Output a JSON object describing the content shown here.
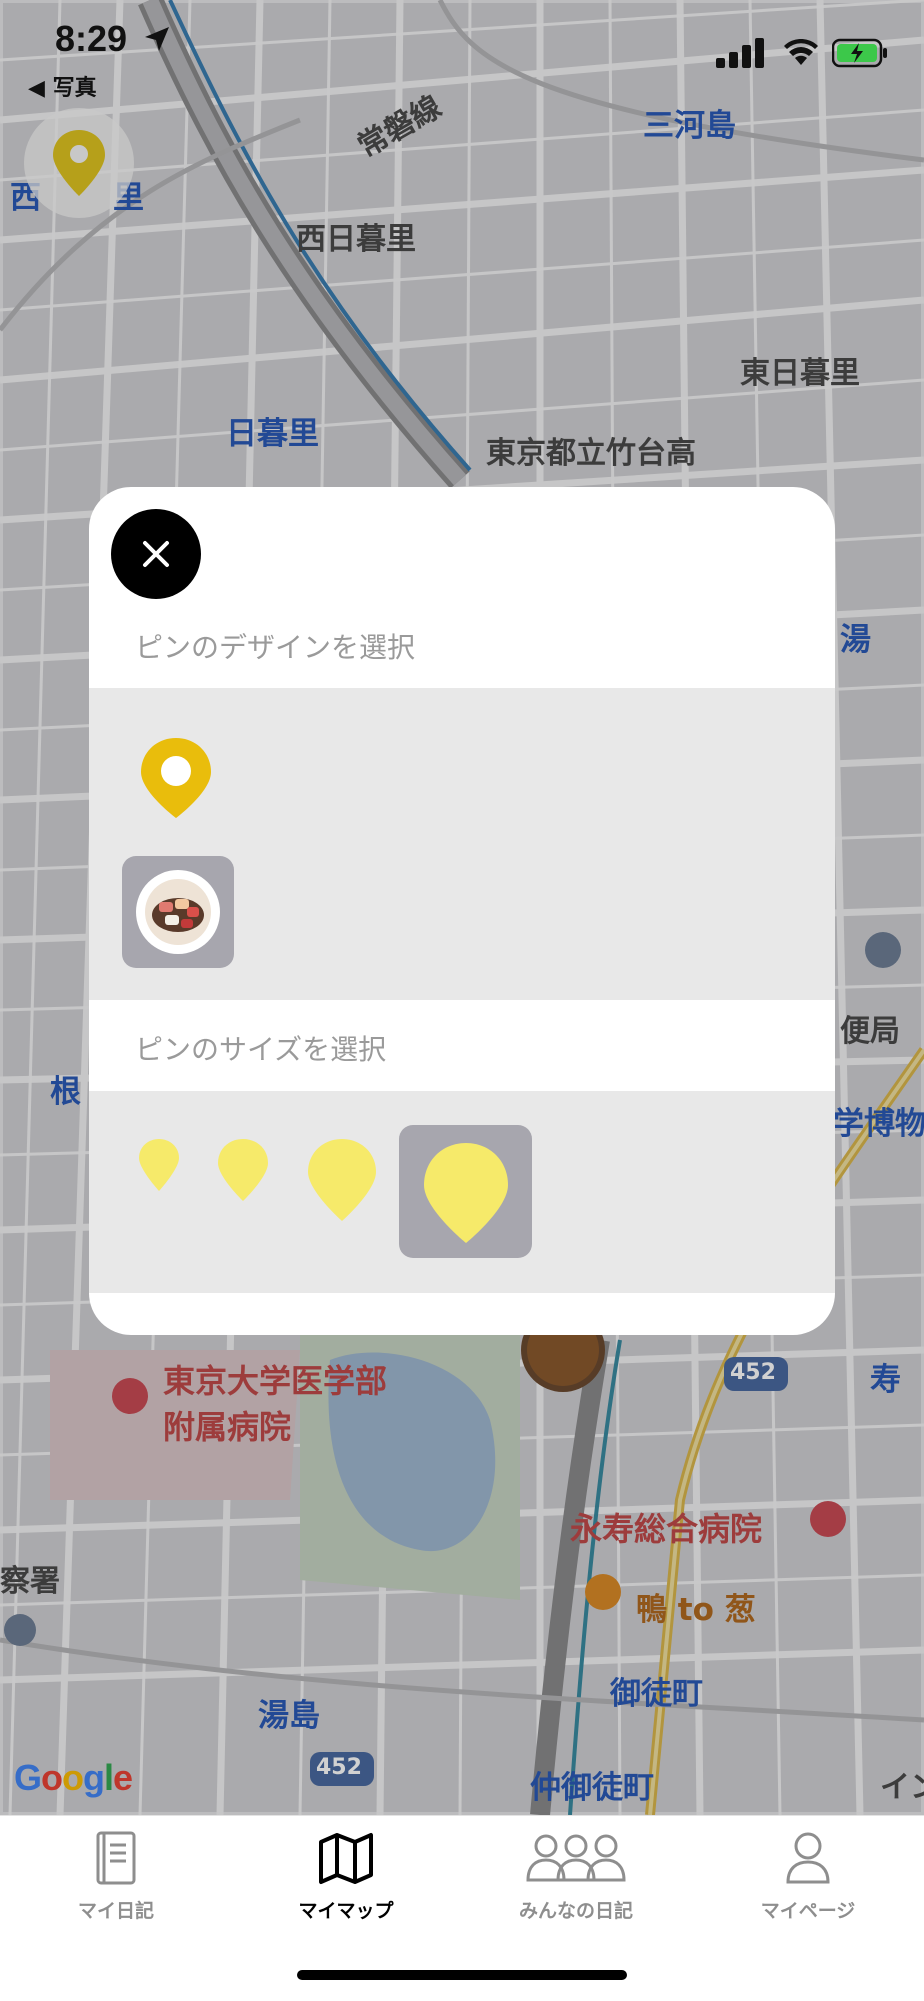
{
  "status_bar": {
    "time": "8:29",
    "back_label": "◀ 写真"
  },
  "map": {
    "labels": {
      "nishinippori": "西日暮里",
      "joban": "常磐線",
      "mikawashima": "三河島",
      "higashinippori": "東日暮里",
      "nippori": "日暮里",
      "takenodai": "東京都立竹台高",
      "yu": "湯",
      "bin": "便局",
      "hakubutsu": "学博物",
      "ne": "根",
      "todai_1": "東京大学医学部",
      "todai_2": "附属病院",
      "route_452a": "452",
      "route_452b": "452",
      "kotobuki": "寿",
      "eiju": "永寿総合病院",
      "kamo": "鴨 to 葱",
      "okachimachi": "御徒町",
      "yushima": "湯島",
      "nakaokachimachi": "仲御徒町",
      "keisatsu": "察署",
      "in": "イン",
      "nishi_partial": "西",
      "ri_partial": "里"
    },
    "logo": "Google"
  },
  "modal": {
    "design_label": "ピンのデザインを選択",
    "size_label": "ピンのサイズを選択",
    "pin_color": "#e9bd0c",
    "size_pin_color": "#f6ea6a",
    "selected_size_index": 3
  },
  "tabbar": {
    "tabs": [
      {
        "label": "マイ日記",
        "icon": "diary-icon",
        "active": false
      },
      {
        "label": "マイマップ",
        "icon": "map-icon",
        "active": true
      },
      {
        "label": "みんなの日記",
        "icon": "people-icon",
        "active": false
      },
      {
        "label": "マイページ",
        "icon": "person-icon",
        "active": false
      }
    ]
  }
}
